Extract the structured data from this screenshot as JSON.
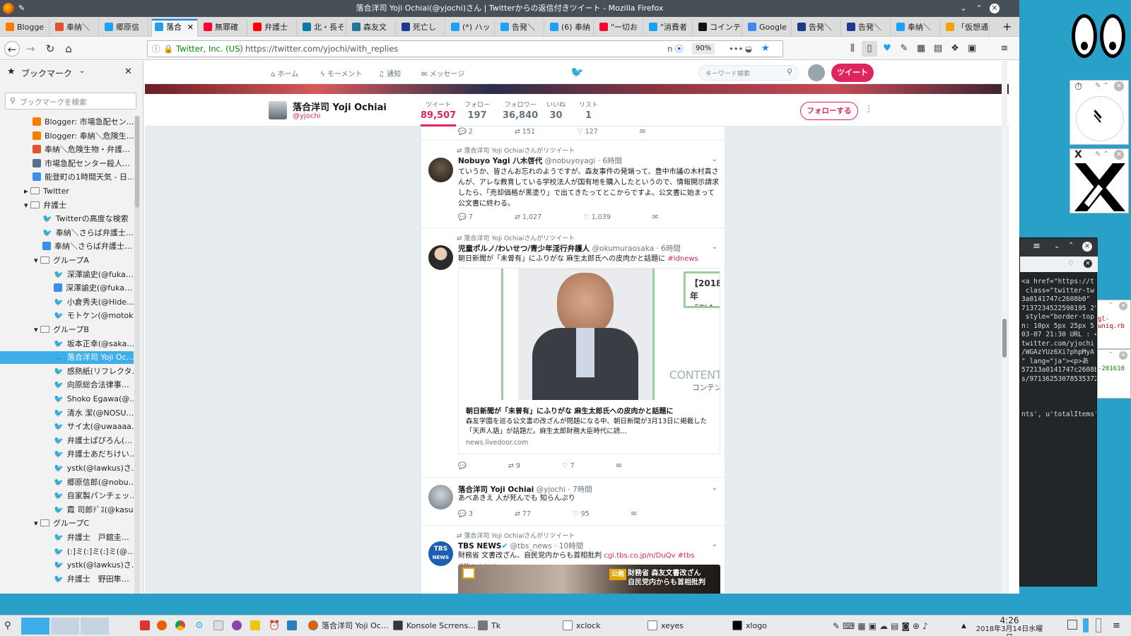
{
  "window": {
    "title": "落合洋司 Yoji Ochiai(@yjochi)さん | Twitterからの返信付きツイート - Mozilla Firefox"
  },
  "tabs": [
    {
      "label": "Blogge",
      "color": "#f57d00"
    },
    {
      "label": "奉納＼",
      "color": "#e0532b"
    },
    {
      "label": "郷原信",
      "color": "#1da1f2"
    },
    {
      "label": "落合",
      "color": "#1da1f2",
      "active": true
    },
    {
      "label": "無罪確",
      "color": "#ff0033"
    },
    {
      "label": "弁護士",
      "color": "#ff0000"
    },
    {
      "label": "北・長そ",
      "color": "#0a7ba8"
    },
    {
      "label": "森友文",
      "color": "#21759b"
    },
    {
      "label": "死亡し",
      "color": "#1d3a8f"
    },
    {
      "label": "(*) ハッ",
      "color": "#1da1f2"
    },
    {
      "label": "告発＼",
      "color": "#1da1f2"
    },
    {
      "label": "(6) 奉納",
      "color": "#1da1f2"
    },
    {
      "label": "\"一切お",
      "color": "#ff0033"
    },
    {
      "label": "\"消費者",
      "color": "#1da1f2"
    },
    {
      "label": "コインテ",
      "color": "#111111"
    },
    {
      "label": "Google",
      "color": "#4285f4"
    },
    {
      "label": "告発＼",
      "color": "#1d3a8f"
    },
    {
      "label": "告発＼",
      "color": "#1d3a8f"
    },
    {
      "label": "奉納＼",
      "color": "#1da1f2"
    },
    {
      "label": "「仮想通",
      "color": "#f2a20c"
    }
  ],
  "urlbar": {
    "identity": "Twitter, Inc. (US)",
    "url": "https://twitter.com/yjochi/with_replies",
    "zoom": "90%"
  },
  "sidebar": {
    "title": "ブックマーク",
    "search_placeholder": "ブックマークを検索",
    "items": [
      {
        "label": "Blogger: 市場急配セン…",
        "indent": 1,
        "kind": "blogger"
      },
      {
        "label": "Blogger: 奉納＼危険生…",
        "indent": 1,
        "kind": "blogger"
      },
      {
        "label": "奉納＼危険生物・弁護…",
        "indent": 1,
        "kind": "page"
      },
      {
        "label": "市場急配センター殺人…",
        "indent": 1,
        "kind": "page2"
      },
      {
        "label": "能登町の1時間天気 - 日…",
        "indent": 1,
        "kind": "weather"
      },
      {
        "label": "Twitter",
        "indent": 1,
        "kind": "folder-closed"
      },
      {
        "label": "弁護士",
        "indent": 1,
        "kind": "folder-open"
      },
      {
        "label": "Twitterの高度な検索",
        "indent": 2,
        "kind": "tw"
      },
      {
        "label": "奉納＼さらば弁護士…",
        "indent": 2,
        "kind": "tw"
      },
      {
        "label": "奉納＼さらば弁護士…",
        "indent": 2,
        "kind": "page3"
      },
      {
        "label": "グループA",
        "indent": 2,
        "kind": "folder-open"
      },
      {
        "label": "深澤諭史(@fuka…",
        "indent": 3,
        "kind": "tw"
      },
      {
        "label": "深澤諭史(@fuka…",
        "indent": 3,
        "kind": "page3"
      },
      {
        "label": "小倉秀夫(@Hide…",
        "indent": 3,
        "kind": "tw"
      },
      {
        "label": "モトケン(@motok…",
        "indent": 3,
        "kind": "tw"
      },
      {
        "label": "グループB",
        "indent": 2,
        "kind": "folder-open"
      },
      {
        "label": "坂本正幸(@saka…",
        "indent": 3,
        "kind": "tw"
      },
      {
        "label": "落合洋司 Yoji Oc…",
        "indent": 3,
        "kind": "tw",
        "selected": true
      },
      {
        "label": "感熱紙(リフレクタ…",
        "indent": 3,
        "kind": "tw"
      },
      {
        "label": "向原総合法律事…",
        "indent": 3,
        "kind": "tw"
      },
      {
        "label": "Shoko Egawa(@…",
        "indent": 3,
        "kind": "tw"
      },
      {
        "label": "清水 潔(@NOSU…",
        "indent": 3,
        "kind": "tw"
      },
      {
        "label": "サイ太(@uwaaaa…",
        "indent": 3,
        "kind": "tw"
      },
      {
        "label": "弁護士ぱぴろん(…",
        "indent": 3,
        "kind": "tw"
      },
      {
        "label": "弁護士あだちけい…",
        "indent": 3,
        "kind": "tw"
      },
      {
        "label": "ystk(@lawkus)さ…",
        "indent": 3,
        "kind": "tw"
      },
      {
        "label": "郷原信郎(@nobu…",
        "indent": 3,
        "kind": "tw"
      },
      {
        "label": "自家製パンチェッ…",
        "indent": 3,
        "kind": "tw"
      },
      {
        "label": "霞 司郎ﾃﾞｽ(@kasu…",
        "indent": 3,
        "kind": "tw"
      },
      {
        "label": "グループC",
        "indent": 2,
        "kind": "folder-open"
      },
      {
        "label": "弁護士　戸舘圭…",
        "indent": 3,
        "kind": "tw"
      },
      {
        "label": "(:]ミ(:]ミ(:]ミ(@…",
        "indent": 3,
        "kind": "tw"
      },
      {
        "label": "ystk(@lawkus)さ…",
        "indent": 3,
        "kind": "tw"
      },
      {
        "label": "弁護士　野田隼…",
        "indent": 3,
        "kind": "tw"
      }
    ]
  },
  "twitter_nav": {
    "home": "ホーム",
    "moments": "モーメント",
    "notifications": "通知",
    "messages": "メッセージ",
    "search_placeholder": "キーワード検索",
    "tweet_button": "ツイート"
  },
  "profile": {
    "name": "落合洋司 Yoji Ochiai",
    "handle": "@yjochi",
    "follow_button": "フォローする",
    "stats": [
      {
        "label": "ツイート",
        "value": "89,507",
        "active": true
      },
      {
        "label": "フォロー",
        "value": "197"
      },
      {
        "label": "フォロワー",
        "value": "36,840"
      },
      {
        "label": "いいね",
        "value": "30"
      },
      {
        "label": "リスト",
        "value": "1"
      }
    ]
  },
  "prev_actions": {
    "reply": "2",
    "retweet": "151",
    "like": "127"
  },
  "tweets": [
    {
      "retweet_label": "落合洋司 Yoji Ochiaiさんがリツイート",
      "name": "Nobuyo Yagi 八木啓代",
      "handle": "@nobuyoyagi",
      "time": "· 6時間",
      "text": "ていうか、皆さんお忘れのようですが、森友事件の発端って、豊中市議の木村真さんが、アレな教育している学校法人が国有地を購入したというので、情報開示請求したら、「売却価格が黒塗り」で出てきたってとこからですよ。公文書に始まって公文書に終わる。",
      "reply": "7",
      "retweet": "1,027",
      "like": "1,039"
    },
    {
      "retweet_label": "落合洋司 Yoji Ochiaiさんがリツイート",
      "name": "児童ポルノ/わいせつ/青少年淫行弁護人",
      "handle": "@okumuraosaka",
      "time": "· 6時間",
      "text": "朝日新聞が「未曾有」にふりがな 麻生太郎氏への皮肉かと話題に",
      "hashtag": "#ldnews",
      "card_badge": "【2018年",
      "card_badge2": "「例会挨",
      "card_watermark": "CONTENT",
      "card_watermark2": "コンテン",
      "card_title": "朝日新聞が「未曾有」にふりがな 麻生太郎氏への皮肉かと話題に",
      "card_desc": "森友学園を巡る公文書の改ざんが問題になる中、朝日新聞が3月13日に掲載した「天声人語」が話題だ。麻生太郎財務大臣時代に読…",
      "card_domain": "news.livedoor.com",
      "reply": "",
      "retweet": "9",
      "like": "7"
    },
    {
      "name": "落合洋司 Yoji Ochiai",
      "handle": "@yjochi",
      "time": "· 7時間",
      "text": "あべあきえ 人が死んでも 知らんぷり",
      "reply": "3",
      "retweet": "77",
      "like": "95"
    },
    {
      "retweet_label": "落合洋司 Yoji Ochiaiさんがリツイート",
      "name": "TBS NEWS",
      "handle": "@tbs_news",
      "time": "· 10時間",
      "text": "財務省 文書改ざん、自民党内からも首相批判",
      "link": "cgi.tbs.co.jp/n/DuQv #tbs #tbs_news",
      "avatar_text1": "TBS",
      "avatar_text2": "NEWS",
      "img_badge": "公務",
      "img_line1": "財務省 森友文書改ざん",
      "img_line2": "自民党内からも首相批判"
    }
  ],
  "terminal": {
    "lines": [
      "<a href=\"https://t",
      " class=\"twitter-tw",
      "3a0141747c2608b0\"",
      "7137234522598195 2\"",
      " style=\"border-top",
      "n: 10px 5px 25px 5",
      "03-07 21:30 URL : <",
      "twitter.com/yjochi",
      "/WGAzYUz6Xi?phpMyA",
      "\" lang=\"ja\"><p>あ",
      "57213a0141747c2608b",
      "s/97136253078535372",
      "",
      "",
      "",
      "nts', u'totalItems'"
    ],
    "side1": "gl-uniq.rb",
    "side2": "-201610"
  },
  "taskbar": {
    "tasks": [
      {
        "label": "落合洋司 Yoji Oc…",
        "icon": "firefox"
      },
      {
        "label": "Konsole Scrrens…",
        "icon": "konsole"
      },
      {
        "label": "Tk",
        "icon": "tk"
      },
      {
        "label": "xclock",
        "icon": "xclock"
      },
      {
        "label": "xeyes",
        "icon": "xeyes"
      },
      {
        "label": "xlogo",
        "icon": "xlogo"
      }
    ],
    "time": "4:26",
    "date": "2018年3月14日水曜日"
  }
}
